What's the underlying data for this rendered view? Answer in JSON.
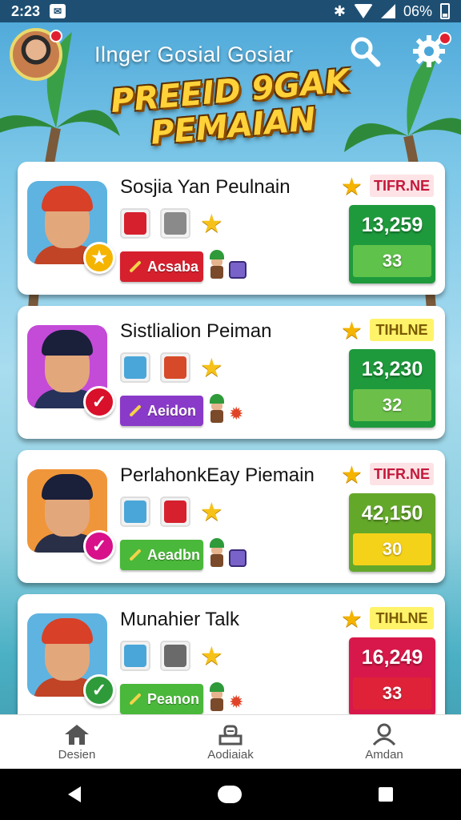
{
  "status": {
    "time": "2:23",
    "battery": "06%"
  },
  "header": {
    "title": "Ilnger Gosial Gosiar"
  },
  "banner": {
    "line1": "PREEID 9GAK",
    "line2": "PEMAIAN"
  },
  "players": [
    {
      "name": "Sosjia Yan Peulnain",
      "tag": "TIFR.NE",
      "tag_bg": "#fde3e6",
      "tag_color": "#c4183a",
      "score": "13,259",
      "sub": "33",
      "score_color": "#1e9a3c",
      "sub_color": "#5fc24a",
      "action": "Acsaba",
      "action_color": "#d6202e",
      "badge": "★",
      "badge_color": "#f4b400",
      "portrait_bg": "#5fb3e0",
      "hair": "#d84028",
      "shirt": "#c14426",
      "item1": "#d6202e",
      "item2": "#8a8a8a",
      "extra": "bag"
    },
    {
      "name": "Sistlialion Peiman",
      "tag": "TIHLNE",
      "tag_bg": "#fff36a",
      "tag_color": "#7a5a00",
      "score": "13,230",
      "sub": "32",
      "score_color": "#1e9a3c",
      "sub_color": "#6cc04a",
      "action": "Aeidon",
      "action_color": "#8a3ac8",
      "badge": "✓",
      "badge_color": "#d8102a",
      "portrait_bg": "#c44ad8",
      "hair": "#1a1f3a",
      "shirt": "#27325a",
      "item1": "#4aa6d8",
      "item2": "#d64a2a",
      "extra": "spiky"
    },
    {
      "name": "PerlahonkEay Piemain",
      "tag": "TIFR.NE",
      "tag_bg": "#fde3e6",
      "tag_color": "#c4183a",
      "score": "42,150",
      "sub": "30",
      "score_color": "#64a82a",
      "sub_color": "#f5d21a",
      "action": "Aeadbn",
      "action_color": "#4ab83a",
      "badge": "✓",
      "badge_color": "#d8108a",
      "portrait_bg": "#f0963a",
      "hair": "#1a1f3a",
      "shirt": "#2a2f48",
      "item1": "#4aa6d8",
      "item2": "#d6202e",
      "extra": "bag"
    },
    {
      "name": "Munahier Talk",
      "tag": "TIHLNE",
      "tag_bg": "#fff36a",
      "tag_color": "#7a5a00",
      "score": "16,249",
      "sub": "33",
      "score_color": "#d8184a",
      "sub_color": "#e02238",
      "action": "Peanon",
      "action_color": "#4ab83a",
      "badge": "✓",
      "badge_color": "#2e9a3a",
      "portrait_bg": "#5fb3e0",
      "hair": "#d84028",
      "shirt": "#c14426",
      "item1": "#4aa6d8",
      "item2": "#6a6a6a",
      "extra": "spiky"
    }
  ],
  "nav": [
    {
      "label": "Desien",
      "icon": "home-icon"
    },
    {
      "label": "Aodiaiak",
      "icon": "leaderboard-icon"
    },
    {
      "label": "Amdan",
      "icon": "profile-icon"
    }
  ]
}
